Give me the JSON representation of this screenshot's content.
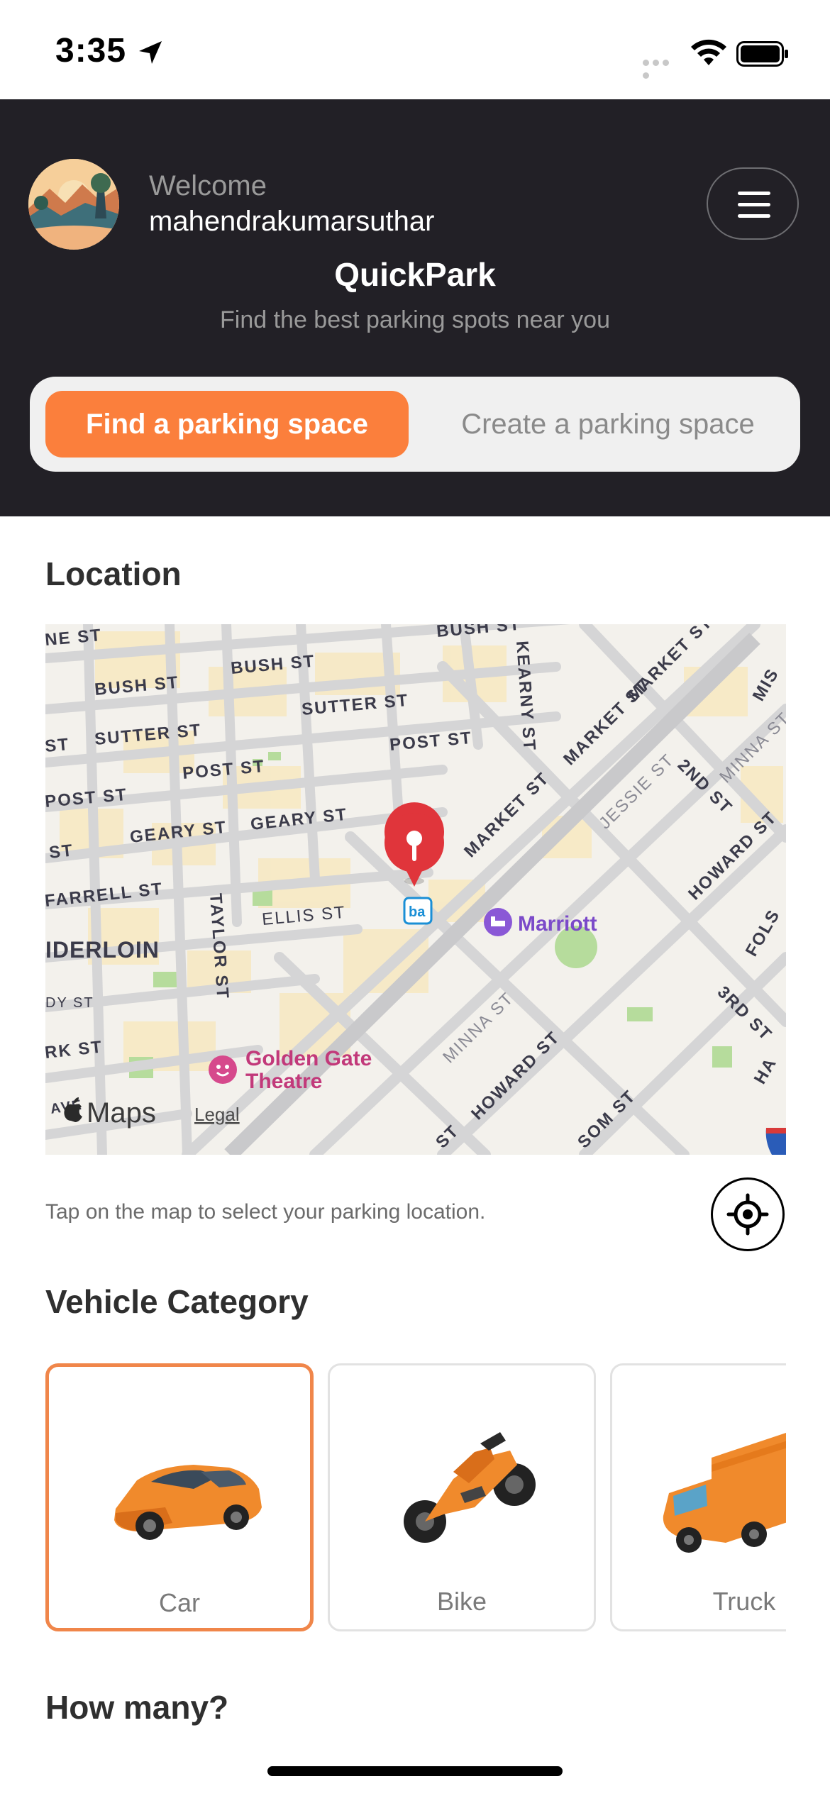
{
  "status_bar": {
    "time": "3:35"
  },
  "header": {
    "welcome": "Welcome",
    "username": "mahendrakumarsuthar",
    "title": "QuickPark",
    "subtitle": "Find the best parking spots near you",
    "tabs": [
      {
        "label": "Find a parking space",
        "active": true
      },
      {
        "label": "Create a parking space",
        "active": false
      }
    ]
  },
  "location": {
    "title": "Location",
    "hint": "Tap on the map to select your parking location.",
    "map": {
      "street_labels": [
        "BUSH ST",
        "BUSH ST",
        "BUSH ST",
        "NE ST",
        "SUTTER ST",
        "SUTTER ST",
        "ST",
        "POST ST",
        "POST ST",
        "POST ST",
        "GEARY ST",
        "GEARY ST",
        "ST",
        "FARRELL ST",
        "ELLIS ST",
        "TAYLOR ST",
        "KEARNY ST",
        "MARKET ST",
        "MARKET ST",
        "MARKET ST",
        "JESSIE ST",
        "2ND ST",
        "MINNA ST",
        "HOWARD ST",
        "HOWARD ST",
        "3RD ST",
        "MINNA ST",
        "FOLS",
        "MIS",
        "HA",
        "IDERLOIN",
        "RK ST",
        "AVE",
        "SOM ST",
        "DY ST",
        "ST"
      ],
      "pois": [
        {
          "name": "Marriott",
          "color": "#7b4ac9"
        },
        {
          "name": "Golden Gate",
          "name2": "Theatre",
          "color": "#c2397a"
        }
      ],
      "attribution": "Maps",
      "legal": "Legal"
    }
  },
  "vehicles": {
    "title": "Vehicle Category",
    "items": [
      {
        "label": "Car",
        "selected": true
      },
      {
        "label": "Bike",
        "selected": false
      },
      {
        "label": "Truck",
        "selected": false
      }
    ]
  },
  "quantity": {
    "title": "How many?"
  },
  "colors": {
    "accent": "#fb7f3c",
    "header_bg": "#222026",
    "pin": "#e0353b"
  }
}
